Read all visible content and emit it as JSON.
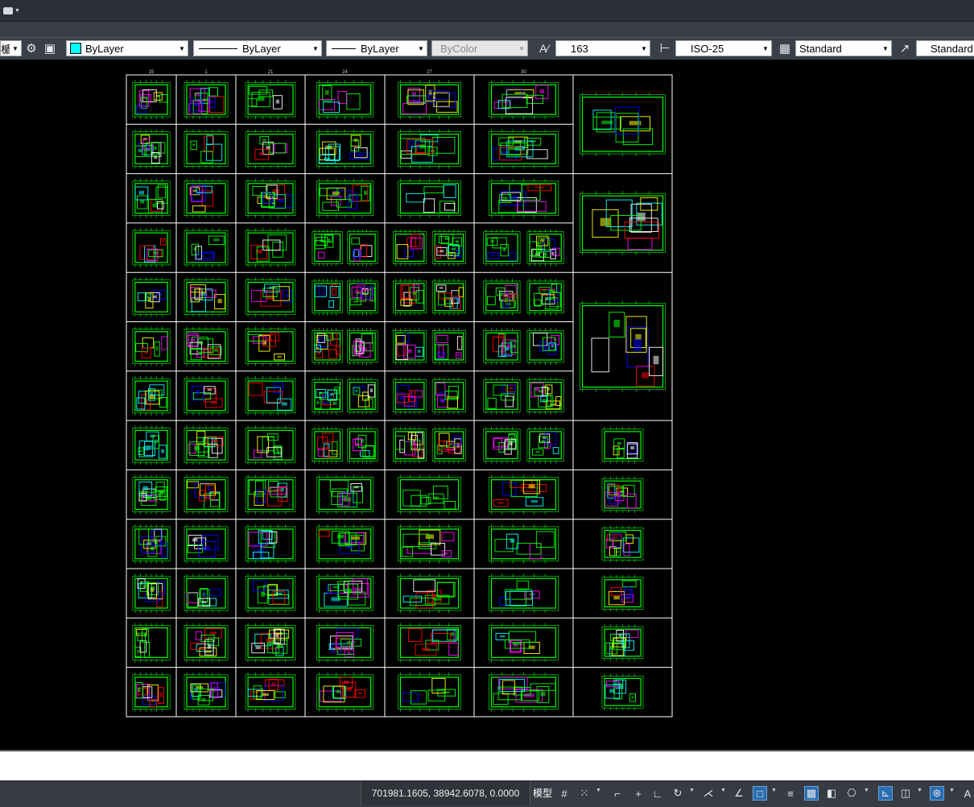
{
  "app": {
    "app_menu_icon": "autocad-app-icon",
    "colors": {
      "canvas": "#000000",
      "chrome": "#3b4048",
      "drawing_frame": "#ffffff",
      "geometry_primary": "#00ff00"
    }
  },
  "properties_toolbar": {
    "layer_fragment": "楯",
    "color_combo": {
      "value": "ByLayer",
      "swatch": "#00ffff"
    },
    "linetype_combo": {
      "value": "ByLayer"
    },
    "lineweight_combo": {
      "value": "ByLayer"
    },
    "plotstyle_combo": {
      "value": "ByColor"
    },
    "text_style_height": "163",
    "dim_style": "ISO-25",
    "table_style": "Standard",
    "multileader_style": "Standard"
  },
  "drawing": {
    "column_numbers": [
      "15",
      "1",
      "21",
      "24",
      "27",
      "30"
    ]
  },
  "status_bar": {
    "coordinates": "701981.1605, 38942.6078, 0.0000",
    "model_label": "模型",
    "icons": [
      "grid-icon",
      "snap-icon",
      "ortho-icon",
      "polar-icon",
      "isodraft-icon",
      "osnap-icon",
      "otrack-icon",
      "lineweight-icon",
      "transparency-icon",
      "selection-cycling-icon",
      "annotation-icon",
      "workspace-icon",
      "units-icon"
    ]
  }
}
